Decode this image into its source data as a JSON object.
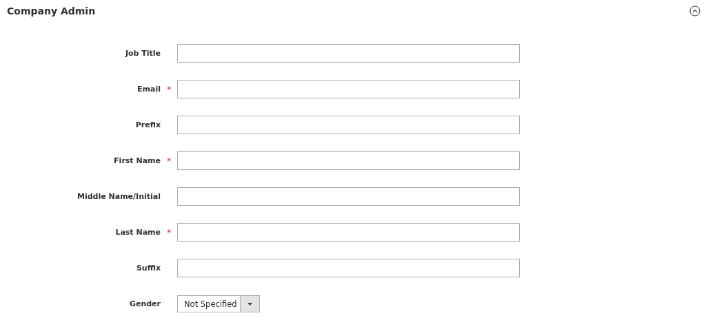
{
  "section": {
    "title": "Company Admin",
    "expanded": true
  },
  "fields": [
    {
      "kind": "text",
      "label": "Job Title"
    },
    {
      "kind": "text",
      "label": "Email",
      "required_mark": "*"
    },
    {
      "kind": "text",
      "label": "Prefix"
    },
    {
      "kind": "text",
      "label": "First Name",
      "required_mark": "*"
    },
    {
      "kind": "text",
      "label": "Middle Name/Initial"
    },
    {
      "kind": "text",
      "label": "Last Name",
      "required_mark": "*"
    },
    {
      "kind": "text",
      "label": "Suffix"
    },
    {
      "kind": "select",
      "label": "Gender",
      "value": "Not Specified"
    }
  ]
}
